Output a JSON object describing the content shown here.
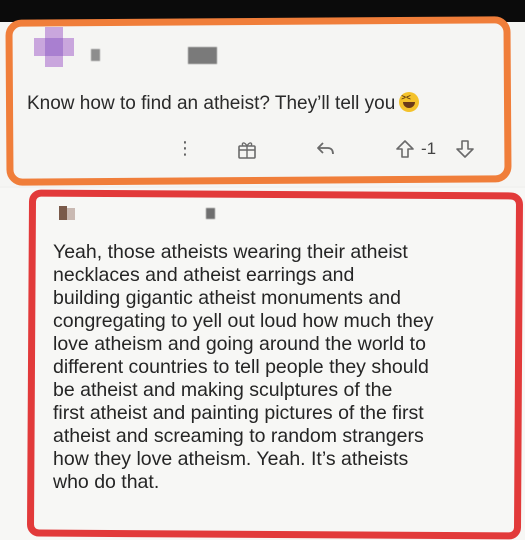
{
  "comment_1": {
    "text": "Know how to find an atheist? They’ll tell you",
    "actions": {
      "more_icon": "more-vertical-icon",
      "award_icon": "gift-icon",
      "reply_icon": "reply-arrow-icon",
      "upvote_icon": "arrow-up-icon",
      "vote_count": "-1",
      "downvote_icon": "arrow-down-icon"
    }
  },
  "comment_2": {
    "lines": [
      "Yeah, those atheists wearing their atheist",
      "necklaces and atheist earrings and",
      "building gigantic atheist monuments and",
      "congregating to yell out loud how much they",
      "love atheism and going around the world to",
      "different countries to tell people they should",
      "be atheist and making sculptures of the",
      "first atheist and painting pictures of the first",
      "atheist and screaming to random strangers",
      "how they love atheism. Yeah. It’s atheists",
      "who do that."
    ]
  },
  "colors": {
    "orange_highlight": "#f07e3a",
    "red_highlight": "#e23a3a"
  }
}
